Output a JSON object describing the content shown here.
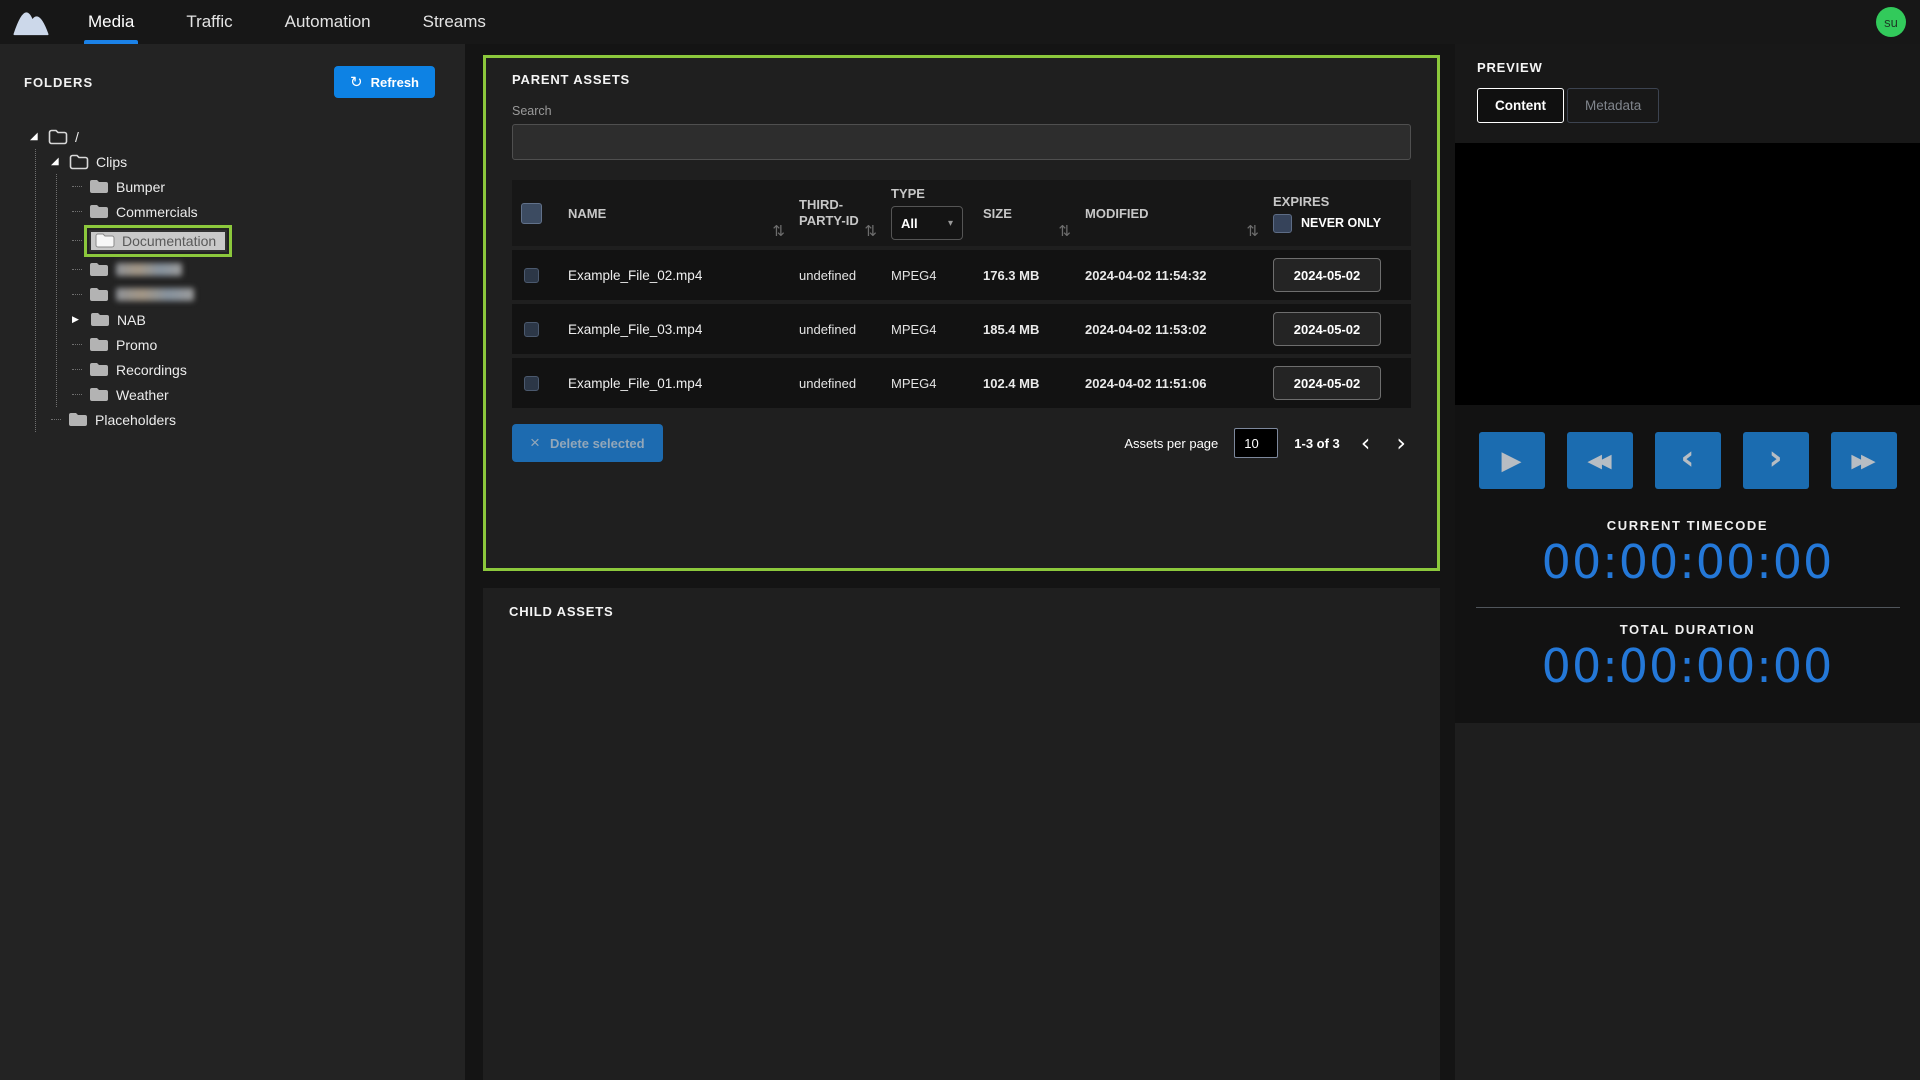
{
  "nav": {
    "tabs": [
      {
        "label": "Media",
        "active": true
      },
      {
        "label": "Traffic",
        "active": false
      },
      {
        "label": "Automation",
        "active": false
      },
      {
        "label": "Streams",
        "active": false
      }
    ],
    "avatar_initials": "su"
  },
  "sidebar": {
    "title": "FOLDERS",
    "refresh_label": "Refresh",
    "folders": [
      {
        "label": "/"
      },
      {
        "label": "Clips"
      },
      {
        "label": "Bumper"
      },
      {
        "label": "Commercials"
      },
      {
        "label": "Documentation",
        "selected": true
      },
      {
        "label": "",
        "blurred": true
      },
      {
        "label": "",
        "blurred": true
      },
      {
        "label": "NAB"
      },
      {
        "label": "Promo"
      },
      {
        "label": "Recordings"
      },
      {
        "label": "Weather"
      },
      {
        "label": "Placeholders"
      }
    ]
  },
  "parent_assets": {
    "title": "PARENT ASSETS",
    "search_label": "Search",
    "search_value": "",
    "columns": {
      "name": "NAME",
      "third_party_id": "THIRD-PARTY-ID",
      "type": "TYPE",
      "size": "SIZE",
      "modified": "MODIFIED",
      "expires": "EXPIRES"
    },
    "type_filter_value": "All",
    "never_only_label": "NEVER ONLY",
    "rows": [
      {
        "name": "Example_File_02.mp4",
        "third_party_id": "undefined",
        "type": "MPEG4",
        "size": "176.3 MB",
        "modified": "2024-04-02 11:54:32",
        "expires": "2024-05-02"
      },
      {
        "name": "Example_File_03.mp4",
        "third_party_id": "undefined",
        "type": "MPEG4",
        "size": "185.4 MB",
        "modified": "2024-04-02 11:53:02",
        "expires": "2024-05-02"
      },
      {
        "name": "Example_File_01.mp4",
        "third_party_id": "undefined",
        "type": "MPEG4",
        "size": "102.4 MB",
        "modified": "2024-04-02 11:51:06",
        "expires": "2024-05-02"
      }
    ],
    "footer": {
      "delete_label": "Delete selected",
      "per_page_label": "Assets per page",
      "per_page_value": "10",
      "range": "1-3 of 3"
    }
  },
  "child_assets": {
    "title": "CHILD ASSETS"
  },
  "preview": {
    "title": "PREVIEW",
    "tabs": [
      {
        "label": "Content",
        "active": true
      },
      {
        "label": "Metadata",
        "active": false
      }
    ],
    "current_timecode_label": "CURRENT TIMECODE",
    "current_timecode": "00:00:00:00",
    "total_duration_label": "TOTAL DURATION",
    "total_duration": "00:00:00:00"
  },
  "icons": {
    "refresh": "↻",
    "sort": "⇅",
    "caret_down": "▾",
    "close": "×",
    "expanded": "◢",
    "collapsed": "▶",
    "play": "▶",
    "rewind": "◀◀",
    "step_back": "‹",
    "step_forward": "›",
    "fast_forward": "▶▶",
    "page_prev": "‹",
    "page_next": "›"
  },
  "colors": {
    "accent_blue": "#0d82e4",
    "player_blue": "#1b6cb0",
    "timecode_blue": "#2478d8",
    "highlight_green": "#8cc83c",
    "avatar_green": "#32ca5b"
  }
}
